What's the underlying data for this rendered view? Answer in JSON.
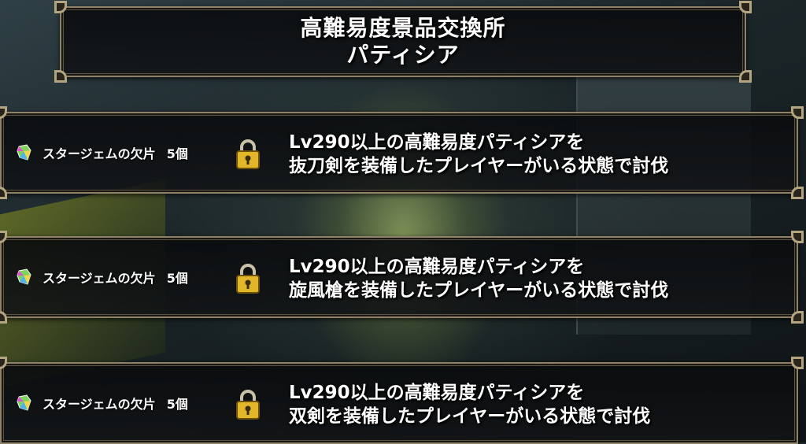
{
  "header": {
    "title_line1": "高難易度景品交換所",
    "title_line2": "パティシア"
  },
  "rewards": [
    {
      "item_name": "スタージェムの欠片",
      "quantity": "5個",
      "icon": "star-gem-fragment-icon",
      "status_icon": "padlock-icon",
      "condition_line1": "Lv290以上の高難易度パティシアを",
      "condition_line2": "抜刀剣を装備したプレイヤーがいる状態で討伐"
    },
    {
      "item_name": "スタージェムの欠片",
      "quantity": "5個",
      "icon": "star-gem-fragment-icon",
      "status_icon": "padlock-icon",
      "condition_line1": "Lv290以上の高難易度パティシアを",
      "condition_line2": "旋風槍を装備したプレイヤーがいる状態で討伐"
    },
    {
      "item_name": "スタージェムの欠片",
      "quantity": "5個",
      "icon": "star-gem-fragment-icon",
      "status_icon": "padlock-icon",
      "condition_line1": "Lv290以上の高難易度パティシアを",
      "condition_line2": "双剣を装備したプレイヤーがいる状態で討伐"
    }
  ],
  "colors": {
    "frame_gold": "#8e8369",
    "lock_gold": "#e2b629",
    "text": "#ffffff"
  }
}
